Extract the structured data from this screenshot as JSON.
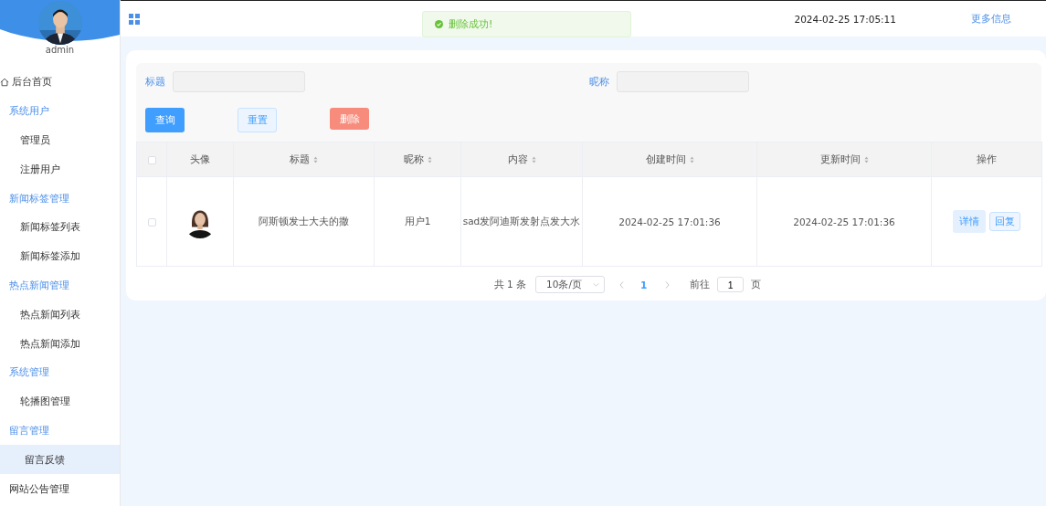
{
  "sidebar": {
    "user": {
      "name": "admin",
      "avatar": {
        "kind": "picture"
      }
    },
    "items": [
      {
        "kind": "home",
        "label": "后台首页",
        "selected": false
      },
      {
        "kind": "group",
        "label": "系统用户",
        "selected": false,
        "children": [
          {
            "label": "管理员",
            "selected": false
          },
          {
            "label": "注册用户",
            "selected": false
          }
        ]
      },
      {
        "kind": "group",
        "label": "新闻标签管理",
        "selected": false,
        "children": [
          {
            "label": "新闻标签列表",
            "selected": false
          },
          {
            "label": "新闻标签添加",
            "selected": false
          }
        ]
      },
      {
        "kind": "group",
        "label": "热点新闻管理",
        "selected": false,
        "children": [
          {
            "label": "热点新闻列表",
            "selected": false
          },
          {
            "label": "热点新闻添加",
            "selected": false
          }
        ]
      },
      {
        "kind": "group",
        "label": "系统管理",
        "selected": false,
        "children": [
          {
            "label": "轮播图管理",
            "selected": false
          }
        ]
      },
      {
        "kind": "group",
        "label": "留言管理",
        "selected": false,
        "children": [
          {
            "label": "留言反馈",
            "selected": true
          }
        ]
      },
      {
        "kind": "link",
        "label": "网站公告管理",
        "selected": false
      }
    ]
  },
  "header": {
    "datetime": "2024-02-25 17:05:11",
    "more_link": "更多信息"
  },
  "toast": {
    "kind": "success",
    "message": "删除成功!"
  },
  "search": {
    "fields": [
      {
        "label": "标题"
      },
      {
        "label": "昵称"
      }
    ],
    "buttons": [
      {
        "kind": "primary",
        "label": "查询"
      },
      {
        "kind": "plain",
        "label": "重置"
      },
      {
        "kind": "danger",
        "label": "删除"
      }
    ]
  },
  "table": {
    "all_checked": false,
    "columns": [
      {
        "label": "头像",
        "sortable": false
      },
      {
        "label": "标题",
        "sortable": true
      },
      {
        "label": "昵称",
        "sortable": true
      },
      {
        "label": "内容",
        "sortable": true
      },
      {
        "label": "创建时间",
        "sortable": true
      },
      {
        "label": "更新时间",
        "sortable": true
      },
      {
        "label": "操作",
        "sortable": false
      }
    ],
    "rows": [
      {
        "checked": false,
        "avatar": {
          "kind": "picture"
        },
        "title": "阿斯顿发士大夫的撒",
        "nickname": "用户1",
        "content": "sad发阿迪斯发射点发大水",
        "created": "2024-02-25 17:01:36",
        "updated": "2024-02-25 17:01:36",
        "actions": [
          {
            "kind": "light",
            "label": "详情"
          },
          {
            "kind": "plain",
            "label": "回复"
          }
        ]
      }
    ]
  },
  "pagination": {
    "total": "共 1 条",
    "page_size": "10条/页",
    "pages": [
      {
        "label": "1",
        "selected": true
      }
    ],
    "goto_label": "前往",
    "goto_value": "1",
    "goto_suffix": "页"
  }
}
